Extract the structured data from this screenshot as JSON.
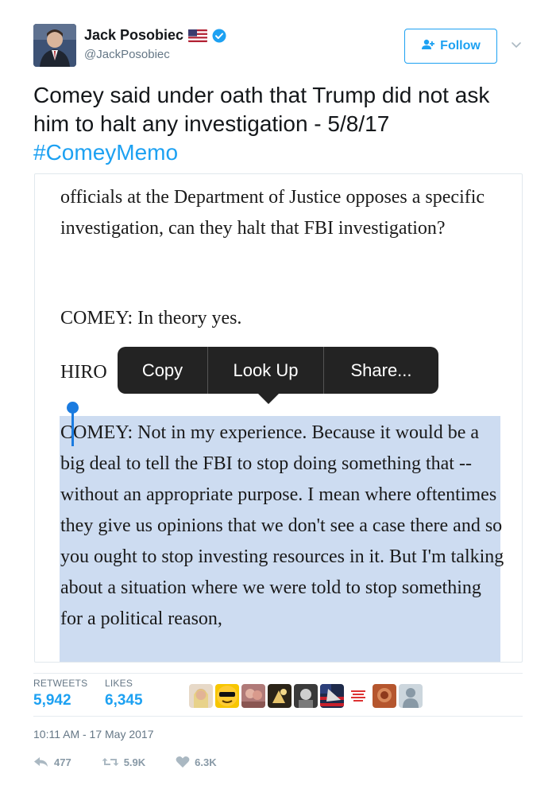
{
  "user": {
    "display_name": "Jack Posobiec",
    "handle": "@JackPosobiec",
    "follow_label": "Follow"
  },
  "tweet": {
    "text": "Comey said under oath that Trump did not ask him to halt any investigation - 5/8/17",
    "hashtag": "#ComeyMemo",
    "timestamp": "10:11 AM - 17 May 2017"
  },
  "media": {
    "paragraph_1": "officials at the Department of Justice opposes a specific investigation, can they halt that FBI investigation?",
    "paragraph_2": "COMEY: In theory yes.",
    "paragraph_3": "HIRO",
    "paragraph_4": "COMEY: Not in my experience. Because it would be a big deal to tell the FBI to stop doing something that -- without an appropriate purpose. I mean where oftentimes they give us opinions that we don't see a case there and so you ought to stop investing resources in it. But I'm talking about a situation where we were told to stop something for a political reason,",
    "popup": {
      "copy": "Copy",
      "look_up": "Look Up",
      "share": "Share..."
    }
  },
  "stats": {
    "retweets_label": "RETWEETS",
    "retweets_value": "5,942",
    "likes_label": "LIKES",
    "likes_value": "6,345"
  },
  "actions": {
    "reply_count": "477",
    "retweet_count": "5.9K",
    "like_count": "6.3K"
  },
  "colors": {
    "accent": "#1da1f2",
    "secondary_text": "#657786",
    "selection": "#cddcf1"
  },
  "icons": [
    "flag-icon",
    "verified-icon",
    "add-user-icon",
    "chevron-down-icon",
    "reply-icon",
    "retweet-icon",
    "heart-icon"
  ]
}
